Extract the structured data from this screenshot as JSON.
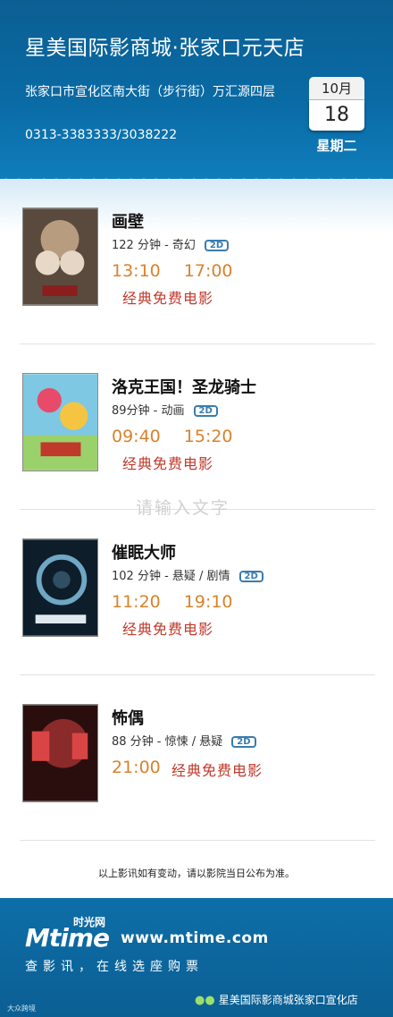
{
  "header": {
    "title": "星美国际影商城·张家口元天店",
    "address": "张家口市宣化区南大街（步行街）万汇源四层",
    "phone": "0313-3383333/3038222",
    "calendar": {
      "month": "10月",
      "day": "18",
      "weekday": "星期二"
    }
  },
  "movies": [
    {
      "name": "画壁",
      "meta": "122 分钟 - 奇幻",
      "format": "2D",
      "times": [
        "13:10",
        "17:00"
      ],
      "note": "经典免费电影"
    },
    {
      "name": "洛克王国！圣龙骑士",
      "meta": "89分钟 - 动画",
      "format": "2D",
      "times": [
        "09:40",
        "15:20"
      ],
      "note": "经典免费电影"
    },
    {
      "name": "催眠大师",
      "meta": "102 分钟 - 悬疑 / 剧情",
      "format": "2D",
      "times": [
        "11:20",
        "19:10"
      ],
      "note": "经典免费电影"
    },
    {
      "name": "怖偶",
      "meta": "88 分钟 - 惊悚 / 悬疑",
      "format": "2D",
      "times": [
        "21:00"
      ],
      "note": "经典免费电影"
    }
  ],
  "watermark": "请输入文字",
  "notice": "以上影讯如有变动，请以影院当日公布为准。",
  "footer": {
    "logo_text": "Mtime",
    "logo_cn": "时光网",
    "site": "www.mtime.com",
    "slogan": "查影讯，在线选座购票",
    "wechat_account": "星美国际影商城张家口宣化店",
    "corner_text": "大众跨境"
  },
  "colors": {
    "header_bg": "#0b5f93",
    "time": "#d9822b",
    "note": "#c0392b",
    "badge": "#3a7cb0"
  }
}
